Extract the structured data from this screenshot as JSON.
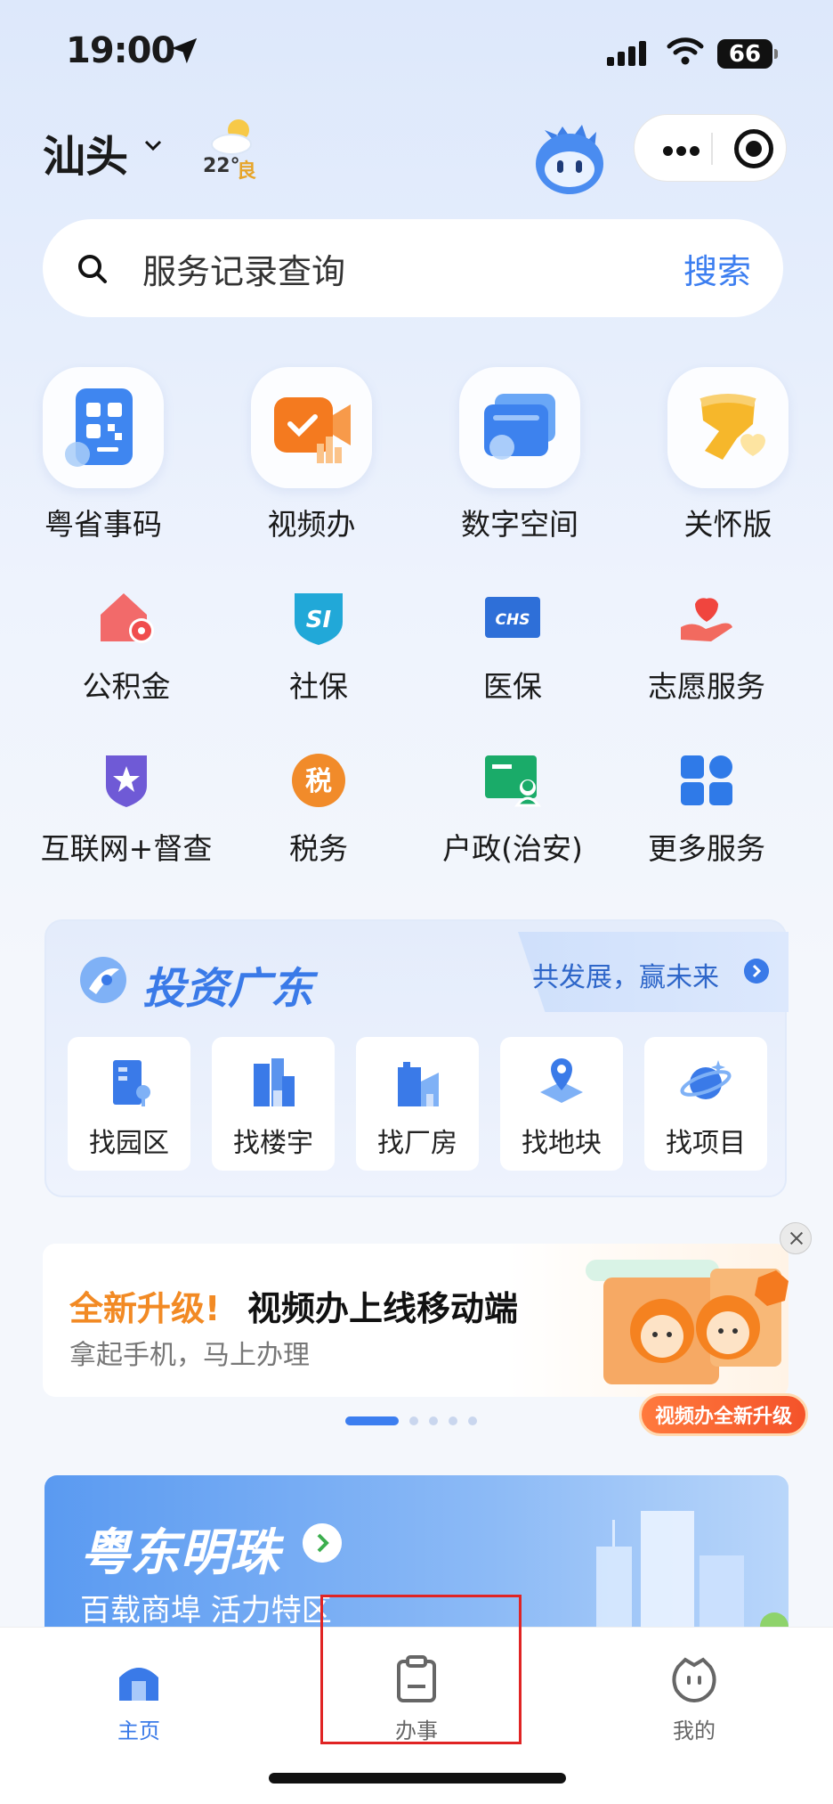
{
  "status_bar": {
    "time": "19:00",
    "battery": "66"
  },
  "header": {
    "city": "汕头",
    "weather_temp": "22°",
    "weather_aqi": "良"
  },
  "search": {
    "placeholder": "服务记录查询",
    "button": "搜索"
  },
  "quick_services": [
    {
      "label": "粤省事码",
      "icon": "qr-code-icon"
    },
    {
      "label": "视频办",
      "icon": "video-service-icon"
    },
    {
      "label": "数字空间",
      "icon": "digital-space-icon"
    },
    {
      "label": "关怀版",
      "icon": "care-ribbon-icon"
    }
  ],
  "services": [
    {
      "label": "公积金",
      "icon": "housing-fund-icon"
    },
    {
      "label": "社保",
      "icon": "social-security-icon"
    },
    {
      "label": "医保",
      "icon": "medical-insurance-icon"
    },
    {
      "label": "志愿服务",
      "icon": "volunteer-icon"
    },
    {
      "label": "互联网+督查",
      "icon": "inspection-icon"
    },
    {
      "label": "税务",
      "icon": "tax-icon"
    },
    {
      "label": "户政(治安)",
      "icon": "household-icon"
    },
    {
      "label": "更多服务",
      "icon": "more-services-icon"
    }
  ],
  "invest": {
    "title": "投资广东",
    "slogan": "共发展，赢未来",
    "items": [
      "找园区",
      "找楼宇",
      "找厂房",
      "找地块",
      "找项目"
    ],
    "si_label": "SI",
    "chs_label": "CHS",
    "tax_char": "税"
  },
  "banner": {
    "highlight": "全新升级!",
    "title": "视频办上线移动端",
    "subtitle": "拿起手机，马上办理",
    "badge": "视频办全新升级"
  },
  "city_card": {
    "title": "粤东明珠",
    "subtitle": "百载商埠  活力特区"
  },
  "tabbar": {
    "home": "主页",
    "affairs": "办事",
    "mine": "我的"
  },
  "colors": {
    "accent": "#3c7ef0",
    "highlight_box": "#e02424",
    "orange": "#f28a24"
  }
}
